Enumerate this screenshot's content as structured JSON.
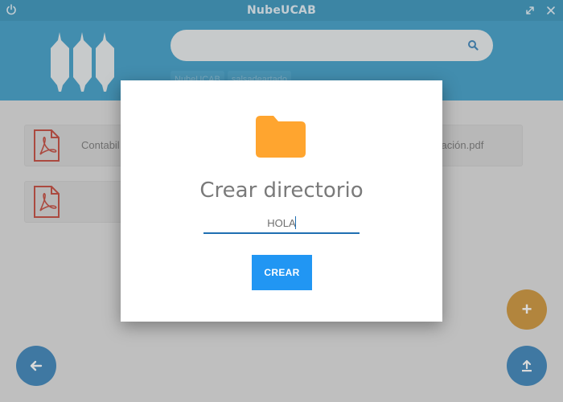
{
  "window": {
    "title": "NubeUCAB"
  },
  "search": {
    "placeholder": "",
    "value": ""
  },
  "breadcrumb": {
    "items": [
      "NubeUCAB",
      "salsadeartado"
    ]
  },
  "files": [
    {
      "name": "Contabil",
      "icon": "pdf-icon"
    },
    {
      "name": "oración.pdf",
      "icon": "pdf-icon"
    },
    {
      "name": "",
      "icon": "pdf-icon"
    }
  ],
  "dialog": {
    "title": "Crear directorio",
    "input_value": "HOLA",
    "button_label": "CREAR",
    "icon": "folder-icon"
  },
  "fabs": {
    "add": "+",
    "back": "←",
    "upload": "upload-icon"
  },
  "colors": {
    "titlebar": "#268bb6",
    "header": "#2f96c4",
    "primary_button": "#2196f3",
    "folder": "#ffa52f",
    "pdf": "#c0392b",
    "fab_blue": "#2a79b3",
    "fab_orange": "#c98b27"
  }
}
